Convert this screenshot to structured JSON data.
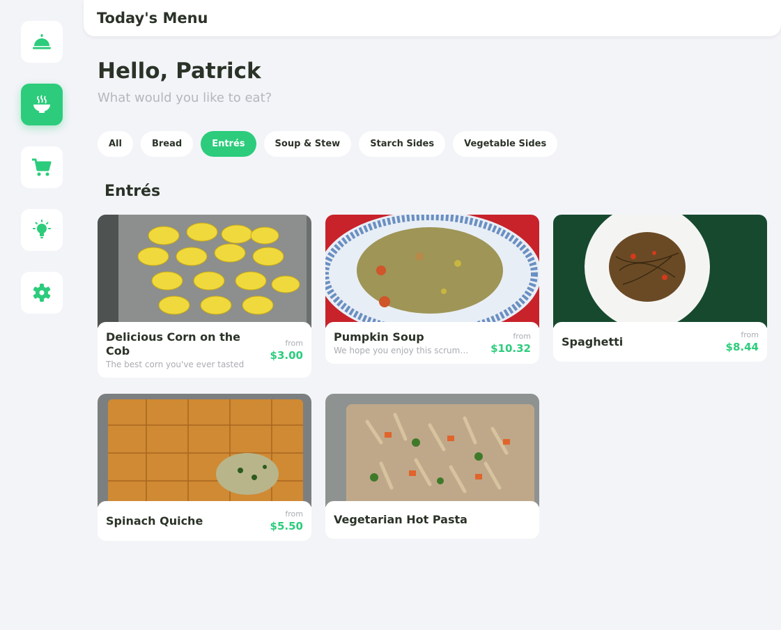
{
  "header": {
    "title": "Today's Menu"
  },
  "greeting": {
    "title": "Hello, Patrick",
    "subtitle": "What would you like to eat?"
  },
  "sidebar": {
    "items": [
      {
        "icon": "cloche-icon",
        "active": false
      },
      {
        "icon": "soup-bowl-icon",
        "active": true
      },
      {
        "icon": "cart-icon",
        "active": false
      },
      {
        "icon": "lightbulb-icon",
        "active": false
      },
      {
        "icon": "gear-icon",
        "active": false
      }
    ]
  },
  "filters": [
    {
      "label": "All",
      "active": false
    },
    {
      "label": "Bread",
      "active": false
    },
    {
      "label": "Entrés",
      "active": true
    },
    {
      "label": "Soup & Stew",
      "active": false
    },
    {
      "label": "Starch Sides",
      "active": false
    },
    {
      "label": "Vegetable Sides",
      "active": false
    }
  ],
  "section": {
    "title": "Entrés"
  },
  "items": [
    {
      "name": "Delicious Corn on the Cob",
      "description": "The best corn you've ever tasted",
      "from_label": "from",
      "price": "$3.00"
    },
    {
      "name": "Pumpkin Soup",
      "description": "We hope you enjoy this scrumptious pumpkin soup",
      "from_label": "from",
      "price": "$10.32"
    },
    {
      "name": "Spaghetti",
      "description": "",
      "from_label": "from",
      "price": "$8.44"
    },
    {
      "name": "Spinach Quiche",
      "description": "",
      "from_label": "from",
      "price": "$5.50"
    },
    {
      "name": "Vegetarian Hot Pasta",
      "description": "",
      "from_label": "",
      "price": ""
    }
  ],
  "colors": {
    "accent": "#2ccc7c",
    "text": "#2b3328",
    "background": "#f3f4f8"
  }
}
